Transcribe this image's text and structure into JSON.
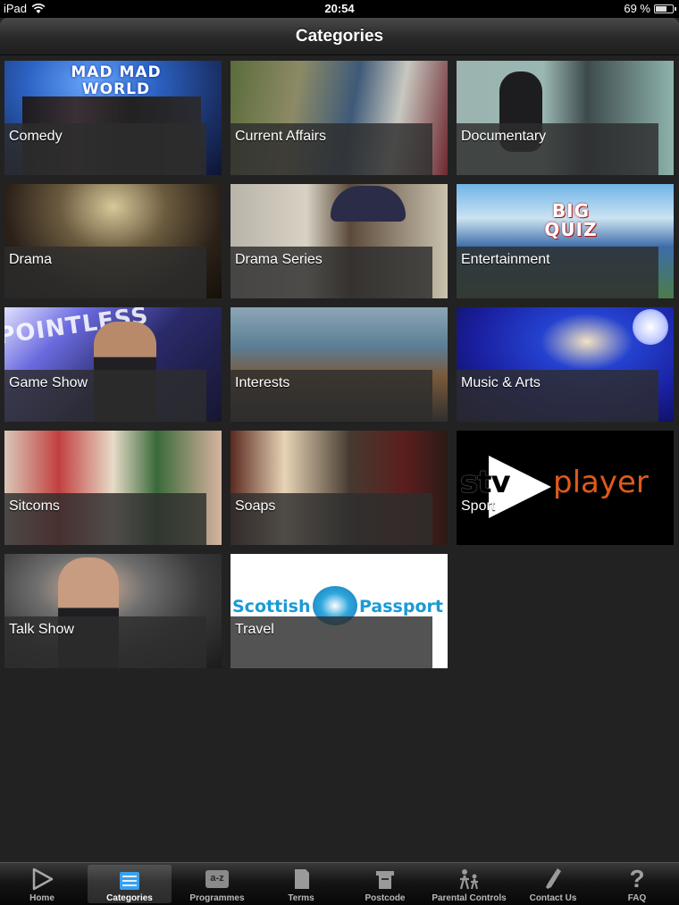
{
  "status": {
    "device": "iPad",
    "time": "20:54",
    "battery": "69 %",
    "battery_level": 0.69
  },
  "navbar": {
    "title": "Categories"
  },
  "tiles": [
    {
      "label": "Comedy",
      "art_text": "MAD MAD WORLD"
    },
    {
      "label": "Current Affairs"
    },
    {
      "label": "Documentary"
    },
    {
      "label": "Drama"
    },
    {
      "label": "Drama Series"
    },
    {
      "label": "Entertainment",
      "art_text": "BIG QUIZ"
    },
    {
      "label": "Game Show",
      "art_text": "POINTLESS"
    },
    {
      "label": "Interests"
    },
    {
      "label": "Music & Arts"
    },
    {
      "label": "Sitcoms"
    },
    {
      "label": "Soaps"
    },
    {
      "label": "Sport",
      "art_text_1": "stv",
      "art_text_2": "player"
    },
    {
      "label": "Talk Show"
    },
    {
      "label": "Travel",
      "art_text_1": "Scottish",
      "art_text_2": "Passport"
    }
  ],
  "tabbar": {
    "tabs": [
      {
        "label": "Home",
        "icon": "play-icon"
      },
      {
        "label": "Categories",
        "icon": "list-icon",
        "selected": true
      },
      {
        "label": "Programmes",
        "icon": "a-z-icon",
        "icon_text": "a-z"
      },
      {
        "label": "Terms",
        "icon": "document-icon"
      },
      {
        "label": "Postcode",
        "icon": "mailbox-icon"
      },
      {
        "label": "Parental Controls",
        "icon": "family-icon"
      },
      {
        "label": "Contact Us",
        "icon": "phone-icon"
      },
      {
        "label": "FAQ",
        "icon": "question-icon",
        "icon_text": "?"
      }
    ]
  },
  "colors": {
    "background": "#222222",
    "tabbar": "#0a0a0a",
    "sport_orange": "#e05a1a",
    "travel_blue": "#1a9ad6"
  }
}
